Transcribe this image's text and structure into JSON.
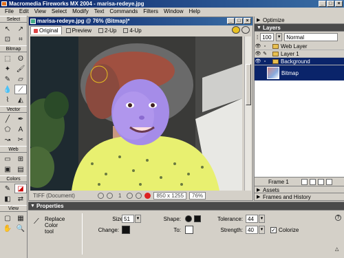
{
  "app": {
    "title": "Macromedia Fireworks MX 2004 - marisa-redeye.jpg"
  },
  "menu": [
    "File",
    "Edit",
    "View",
    "Select",
    "Modify",
    "Text",
    "Commands",
    "Filters",
    "Window",
    "Help"
  ],
  "tools": {
    "sections": {
      "select": "Select",
      "bitmap": "Bitmap",
      "vector": "Vector",
      "web": "Web",
      "colors": "Colors",
      "view": "View"
    }
  },
  "document": {
    "title": "marisa-redeye.jpg @ 76% (Bitmap)*",
    "tabs": [
      "Original",
      "Preview",
      "2-Up",
      "4-Up"
    ],
    "frame_number": "1",
    "file_type": "TIFF (Document)",
    "dimensions": "850 x 1255",
    "zoom": "76%"
  },
  "panels": {
    "optimize": "Optimize",
    "layers": "Layers",
    "opacity": "100",
    "blend_mode": "Normal",
    "layer_items": [
      "Web Layer",
      "Layer 1",
      "Background"
    ],
    "bitmap_object": "Bitmap",
    "frame_label": "Frame 1",
    "assets": "Assets",
    "frames_history": "Frames and History"
  },
  "properties": {
    "header": "Properties",
    "tool_name": "Replace Color\ntool",
    "size_label": "Size:",
    "size_value": "51",
    "change_label": "Change:",
    "shape_label": "Shape:",
    "to_label": "To:",
    "tolerance_label": "Tolerance:",
    "tolerance_value": "44",
    "strength_label": "Strength:",
    "strength_value": "40",
    "colorize_label": "Colorize",
    "colorize_checked": true
  },
  "colors": {
    "titlebar": "#0a246a",
    "selection": "#0a246a",
    "face_tint": "#a080e8",
    "shirt": "#e8f070",
    "hair": "#a05040"
  }
}
